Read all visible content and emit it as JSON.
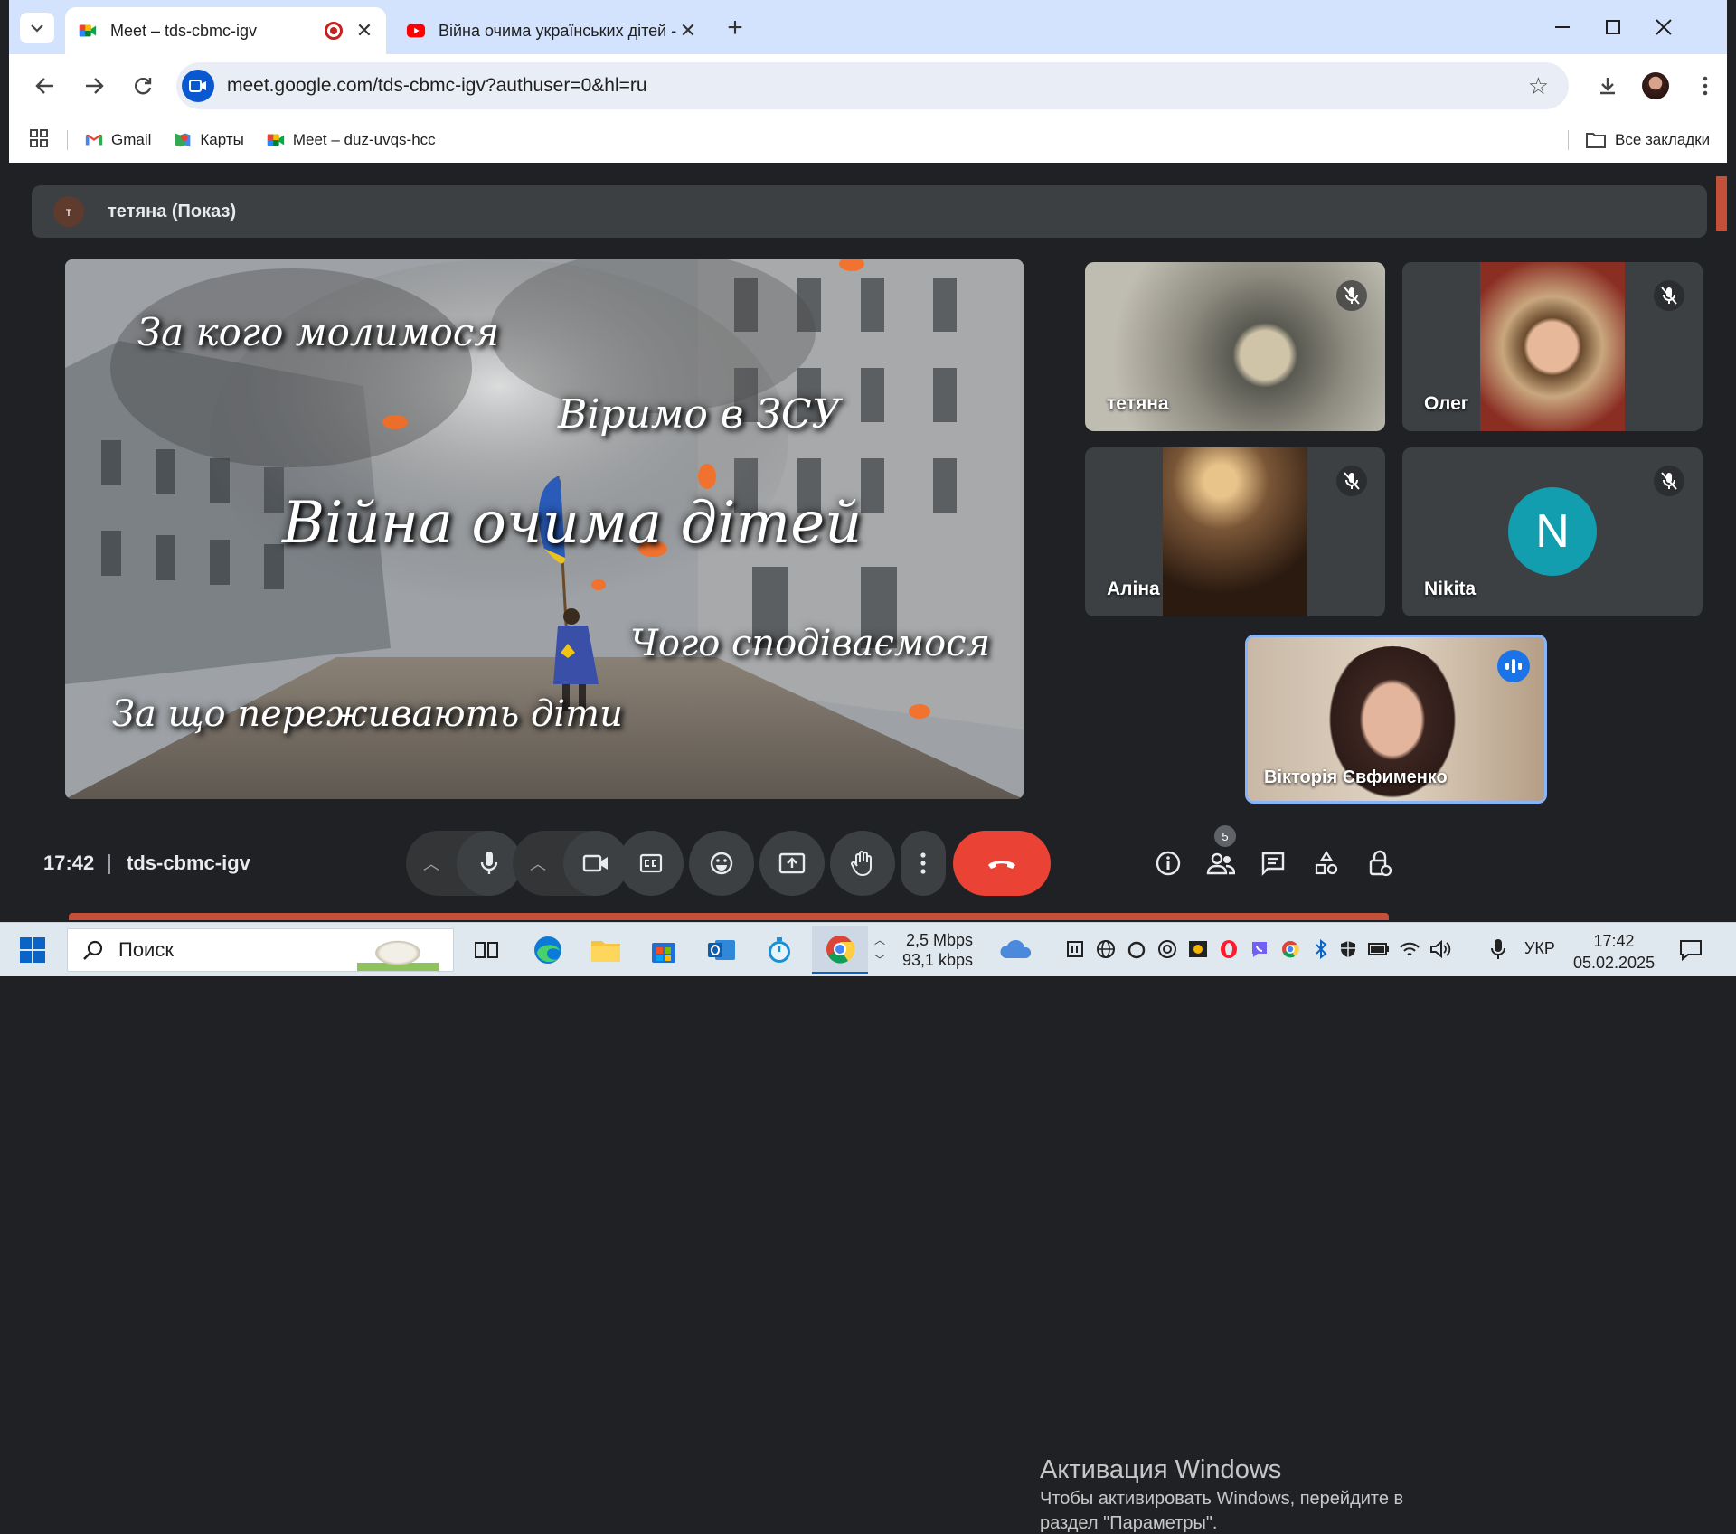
{
  "browser": {
    "tabs": [
      {
        "title": "Meet – tds-cbmc-igv",
        "active": true,
        "recording": true
      },
      {
        "title": "Війна очима українських дітей - Y",
        "active": false
      }
    ],
    "url": "meet.google.com/tds-cbmc-igv?authuser=0&hl=ru",
    "bookmarks": [
      {
        "label": "Gmail"
      },
      {
        "label": "Карты"
      },
      {
        "label": "Meet – duz-uvqs-hcc"
      }
    ],
    "all_bookmarks": "Все закладки"
  },
  "meet": {
    "presenter": {
      "initial": "т",
      "label": "тетяна (Показ)"
    },
    "slide": {
      "title": "Війна очима дітей",
      "phrases": [
        "За кого молимося",
        "Віримо в ЗСУ",
        "Чого сподіваємося",
        "За що переживають діти"
      ]
    },
    "participants": [
      {
        "name": "тетяна",
        "muted": true
      },
      {
        "name": "Олег",
        "muted": true
      },
      {
        "name": "Аліна",
        "muted": true
      },
      {
        "name": "Nikita",
        "initial": "N",
        "muted": true,
        "avatar_color": "#129eaf"
      }
    ],
    "self": {
      "name": "Вікторія Євфименко",
      "speaking": true
    },
    "bottom_bar": {
      "time": "17:42",
      "meeting_code": "tds-cbmc-igv",
      "participant_count": "5"
    }
  },
  "watermark": {
    "line1": "Активация Windows",
    "line2": "Чтобы активировать Windows, перейдите в",
    "line3": "раздел \"Параметры\"."
  },
  "taskbar": {
    "search_placeholder": "Поиск",
    "net_up": "2,5 Mbps",
    "net_down": "93,1 kbps",
    "language": "УКР",
    "time": "17:42",
    "date": "05.02.2025"
  }
}
